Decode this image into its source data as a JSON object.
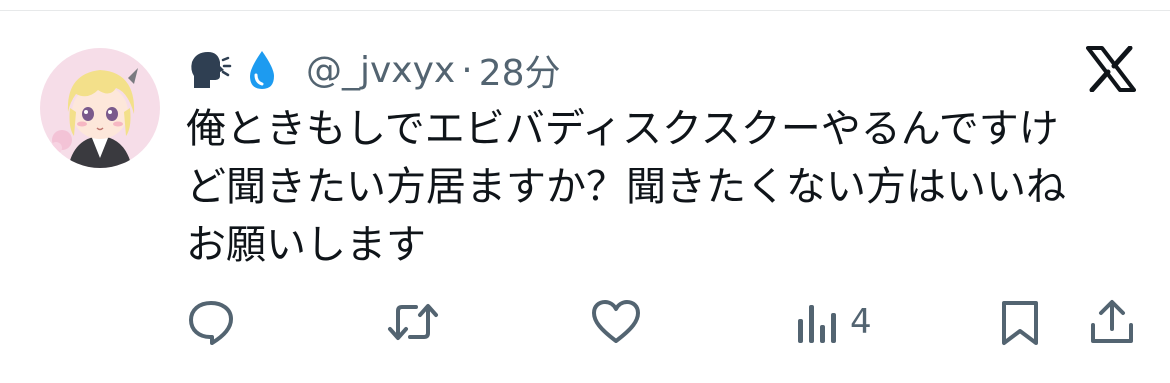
{
  "tweet": {
    "emojis": [
      "speaking-head-emoji",
      "droplet-emoji"
    ],
    "handle": "@_jvxyx",
    "separator": "·",
    "time": "28分",
    "lines": [
      "俺ときもしでエビバディスクスクーやるんですけ",
      "ど聞きたい方居ますか？聞きたくない方はいいね",
      "お願いします"
    ]
  },
  "actions": {
    "views_count": "4"
  },
  "icons": {
    "reply": "reply-icon",
    "retweet": "retweet-icon",
    "like": "heart-icon",
    "views": "views-icon",
    "bookmark": "bookmark-icon",
    "share": "share-icon",
    "logo": "x-logo-icon"
  },
  "colors": {
    "text": "#0f1419",
    "secondary": "#536471",
    "droplet": "#1d9bf0",
    "border": "#e7e9ea"
  }
}
